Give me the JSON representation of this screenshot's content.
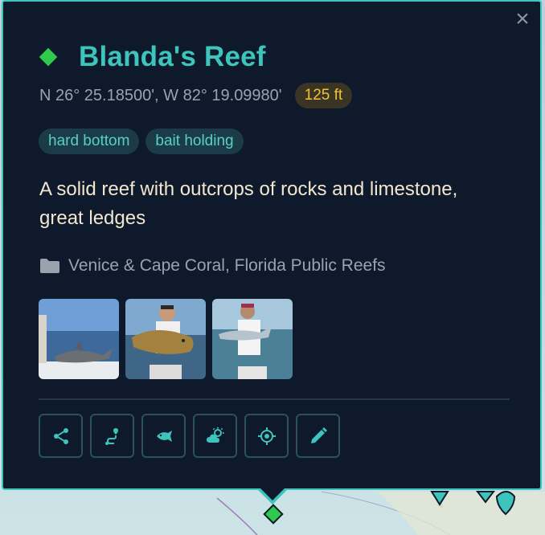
{
  "popup": {
    "title": "Blanda's Reef",
    "coordinates": "N 26° 25.18500', W 82° 19.09980'",
    "depth": "125 ft",
    "tags": [
      "hard bottom",
      "bait holding"
    ],
    "description": "A solid reef with outcrops of rocks and limestone, great ledges",
    "group": "Venice & Cape Coral, Florida Public Reefs",
    "close_label": "×",
    "photos": [
      {
        "subject": "shark caught off boat"
      },
      {
        "subject": "angler holding grouper"
      },
      {
        "subject": "angler holding bonito"
      }
    ],
    "actions": [
      {
        "name": "share",
        "icon": "share-icon"
      },
      {
        "name": "route",
        "icon": "route-icon"
      },
      {
        "name": "log-catch",
        "icon": "fish-icon"
      },
      {
        "name": "weather",
        "icon": "weather-icon"
      },
      {
        "name": "navigate",
        "icon": "target-icon"
      },
      {
        "name": "edit",
        "icon": "pencil-icon"
      }
    ]
  },
  "colors": {
    "accent": "#3cc4bd",
    "marker": "#2ec94d",
    "depth_text": "#f1c232",
    "background": "#0e1a2b"
  }
}
